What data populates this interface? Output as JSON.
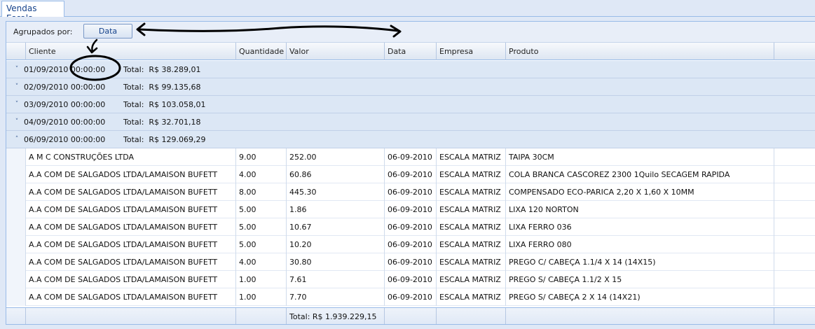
{
  "tab": {
    "label": "Vendas Escala"
  },
  "group_panel": {
    "label": "Agrupados por:",
    "chip": "Data"
  },
  "columns": [
    "Cliente",
    "Quantidade",
    "Valor",
    "Data",
    "Empresa",
    "Produto"
  ],
  "groups": [
    {
      "date": "01/09/2010 00:00:00",
      "total_label": "Total:",
      "total": "R$ 38.289,01",
      "expanded": false,
      "toggle": "˅"
    },
    {
      "date": "02/09/2010 00:00:00",
      "total_label": "Total:",
      "total": "R$ 99.135,68",
      "expanded": false,
      "toggle": "˅"
    },
    {
      "date": "03/09/2010 00:00:00",
      "total_label": "Total:",
      "total": "R$ 103.058,01",
      "expanded": false,
      "toggle": "˅"
    },
    {
      "date": "04/09/2010 00:00:00",
      "total_label": "Total:",
      "total": "R$ 32.701,18",
      "expanded": false,
      "toggle": "˅"
    },
    {
      "date": "06/09/2010 00:00:00",
      "total_label": "Total:",
      "total": "R$ 129.069,29",
      "expanded": true,
      "toggle": "˄"
    }
  ],
  "rows": [
    [
      "A M C CONSTRUÇÕES LTDA",
      "9.00",
      "252.00",
      "06-09-2010",
      "ESCALA MATRIZ",
      "TAIPA 30CM"
    ],
    [
      "A.A COM DE SALGADOS LTDA/LAMAISON BUFETT",
      "4.00",
      "60.86",
      "06-09-2010",
      "ESCALA MATRIZ",
      "COLA BRANCA CASCOREZ 2300 1Quilo SECAGEM RAPIDA"
    ],
    [
      "A.A COM DE SALGADOS LTDA/LAMAISON BUFETT",
      "8.00",
      "445.30",
      "06-09-2010",
      "ESCALA MATRIZ",
      "COMPENSADO ECO-PARICA 2,20 X 1,60 X 10MM"
    ],
    [
      "A.A COM DE SALGADOS LTDA/LAMAISON BUFETT",
      "5.00",
      "1.86",
      "06-09-2010",
      "ESCALA MATRIZ",
      "LIXA 120 NORTON"
    ],
    [
      "A.A COM DE SALGADOS LTDA/LAMAISON BUFETT",
      "5.00",
      "10.67",
      "06-09-2010",
      "ESCALA MATRIZ",
      "LIXA FERRO 036"
    ],
    [
      "A.A COM DE SALGADOS LTDA/LAMAISON BUFETT",
      "5.00",
      "10.20",
      "06-09-2010",
      "ESCALA MATRIZ",
      "LIXA FERRO 080"
    ],
    [
      "A.A COM DE SALGADOS LTDA/LAMAISON BUFETT",
      "4.00",
      "30.80",
      "06-09-2010",
      "ESCALA MATRIZ",
      "PREGO C/ CABEÇA 1.1/4 X 14 (14X15)"
    ],
    [
      "A.A COM DE SALGADOS LTDA/LAMAISON BUFETT",
      "1.00",
      "7.61",
      "06-09-2010",
      "ESCALA MATRIZ",
      "PREGO S/ CABEÇA 1.1/2 X 15"
    ],
    [
      "A.A COM DE SALGADOS LTDA/LAMAISON BUFETT",
      "1.00",
      "7.70",
      "06-09-2010",
      "ESCALA MATRIZ",
      "PREGO S/ CABEÇA 2 X 14 (14X21)"
    ]
  ],
  "footer": {
    "total": "Total: R$ 1.939.229,15"
  },
  "colors": {
    "header_bg": "#dfe8f6",
    "border": "#99bbe8",
    "group_row": "#dce7f5",
    "annotation_ink": "#000000"
  }
}
